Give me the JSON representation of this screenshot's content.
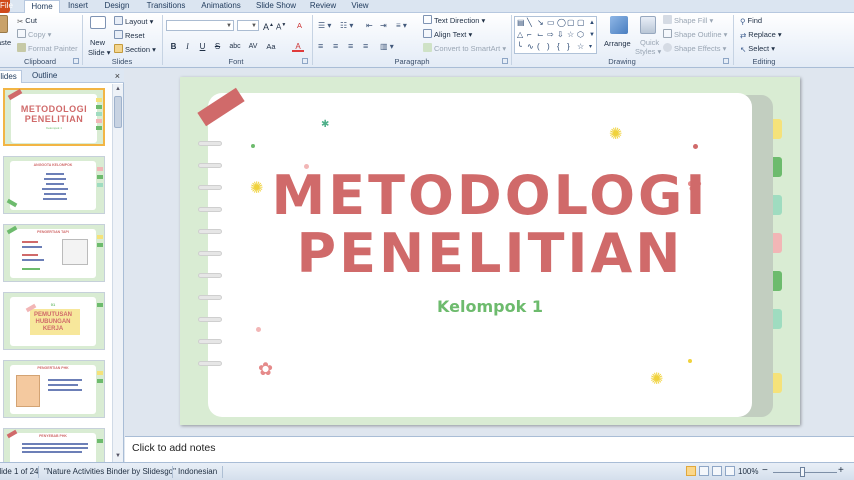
{
  "tabs": [
    {
      "label": "File"
    },
    {
      "label": "Home"
    },
    {
      "label": "Insert"
    },
    {
      "label": "Design"
    },
    {
      "label": "Transitions"
    },
    {
      "label": "Animations"
    },
    {
      "label": "Slide Show"
    },
    {
      "label": "Review"
    },
    {
      "label": "View"
    }
  ],
  "ribbon": {
    "clipboard": {
      "label": "Clipboard",
      "paste": "Paste",
      "cut": "Cut",
      "copy": "Copy",
      "format_painter": "Format Painter"
    },
    "slides": {
      "label": "Slides",
      "new_slide_1": "New",
      "new_slide_2": "Slide",
      "layout": "Layout",
      "reset": "Reset",
      "section": "Section"
    },
    "font": {
      "label": "Font",
      "font_name": "",
      "font_size": "",
      "bold": "B",
      "italic": "I",
      "underline": "U",
      "strikethrough": "S",
      "shadow": "abc",
      "spacing": "AV",
      "case": "Aa",
      "grow": "A",
      "shrink": "A",
      "clear": "A",
      "color": "A"
    },
    "paragraph": {
      "label": "Paragraph",
      "text_direction": "Text Direction",
      "align_text": "Align Text",
      "convert_smartart": "Convert to SmartArt"
    },
    "drawing": {
      "label": "Drawing",
      "arrange": "Arrange",
      "quick_styles_1": "Quick",
      "quick_styles_2": "Styles",
      "shape_fill": "Shape Fill",
      "shape_outline": "Shape Outline",
      "shape_effects": "Shape Effects"
    },
    "editing": {
      "label": "Editing",
      "find": "Find",
      "replace": "Replace",
      "select": "Select"
    }
  },
  "panel": {
    "tab_slides": "Slides",
    "tab_outline": "Outline",
    "close": "×",
    "thumbnails": [
      {
        "title_1": "METODOLOGI",
        "title_2": "PENELITIAN",
        "subtitle": "Kelompok 1"
      },
      {
        "title_1": "ANGGOTA KELOMPOK"
      },
      {
        "title_1": "PENGERTIAN TAPI"
      },
      {
        "num": "01",
        "title_1": "PEMUTUSAN",
        "title_2": "HUBUNGAN",
        "title_3": "KERJA"
      },
      {
        "title_1": "PENGERTIAN PHK"
      },
      {
        "title_1": "PENYEBAB PHK"
      }
    ]
  },
  "slide": {
    "title_line1": "METODOLOGI",
    "title_line2": "PENELITIAN",
    "subtitle": "Kelompok 1"
  },
  "notes": {
    "placeholder": "Click to add notes"
  },
  "status": {
    "slide_counter": "Slide 1 of 24",
    "theme": "\"Nature Activities Binder by Slidesgo\"",
    "language": "Indonesian",
    "zoom": "100%",
    "zoom_minus": "−",
    "zoom_plus": "+"
  },
  "colors": {
    "accent_red": "#d06a6a",
    "accent_green": "#6dbb6d",
    "slide_bg": "#d9ecd3",
    "file_tab": "#d04a1b"
  }
}
